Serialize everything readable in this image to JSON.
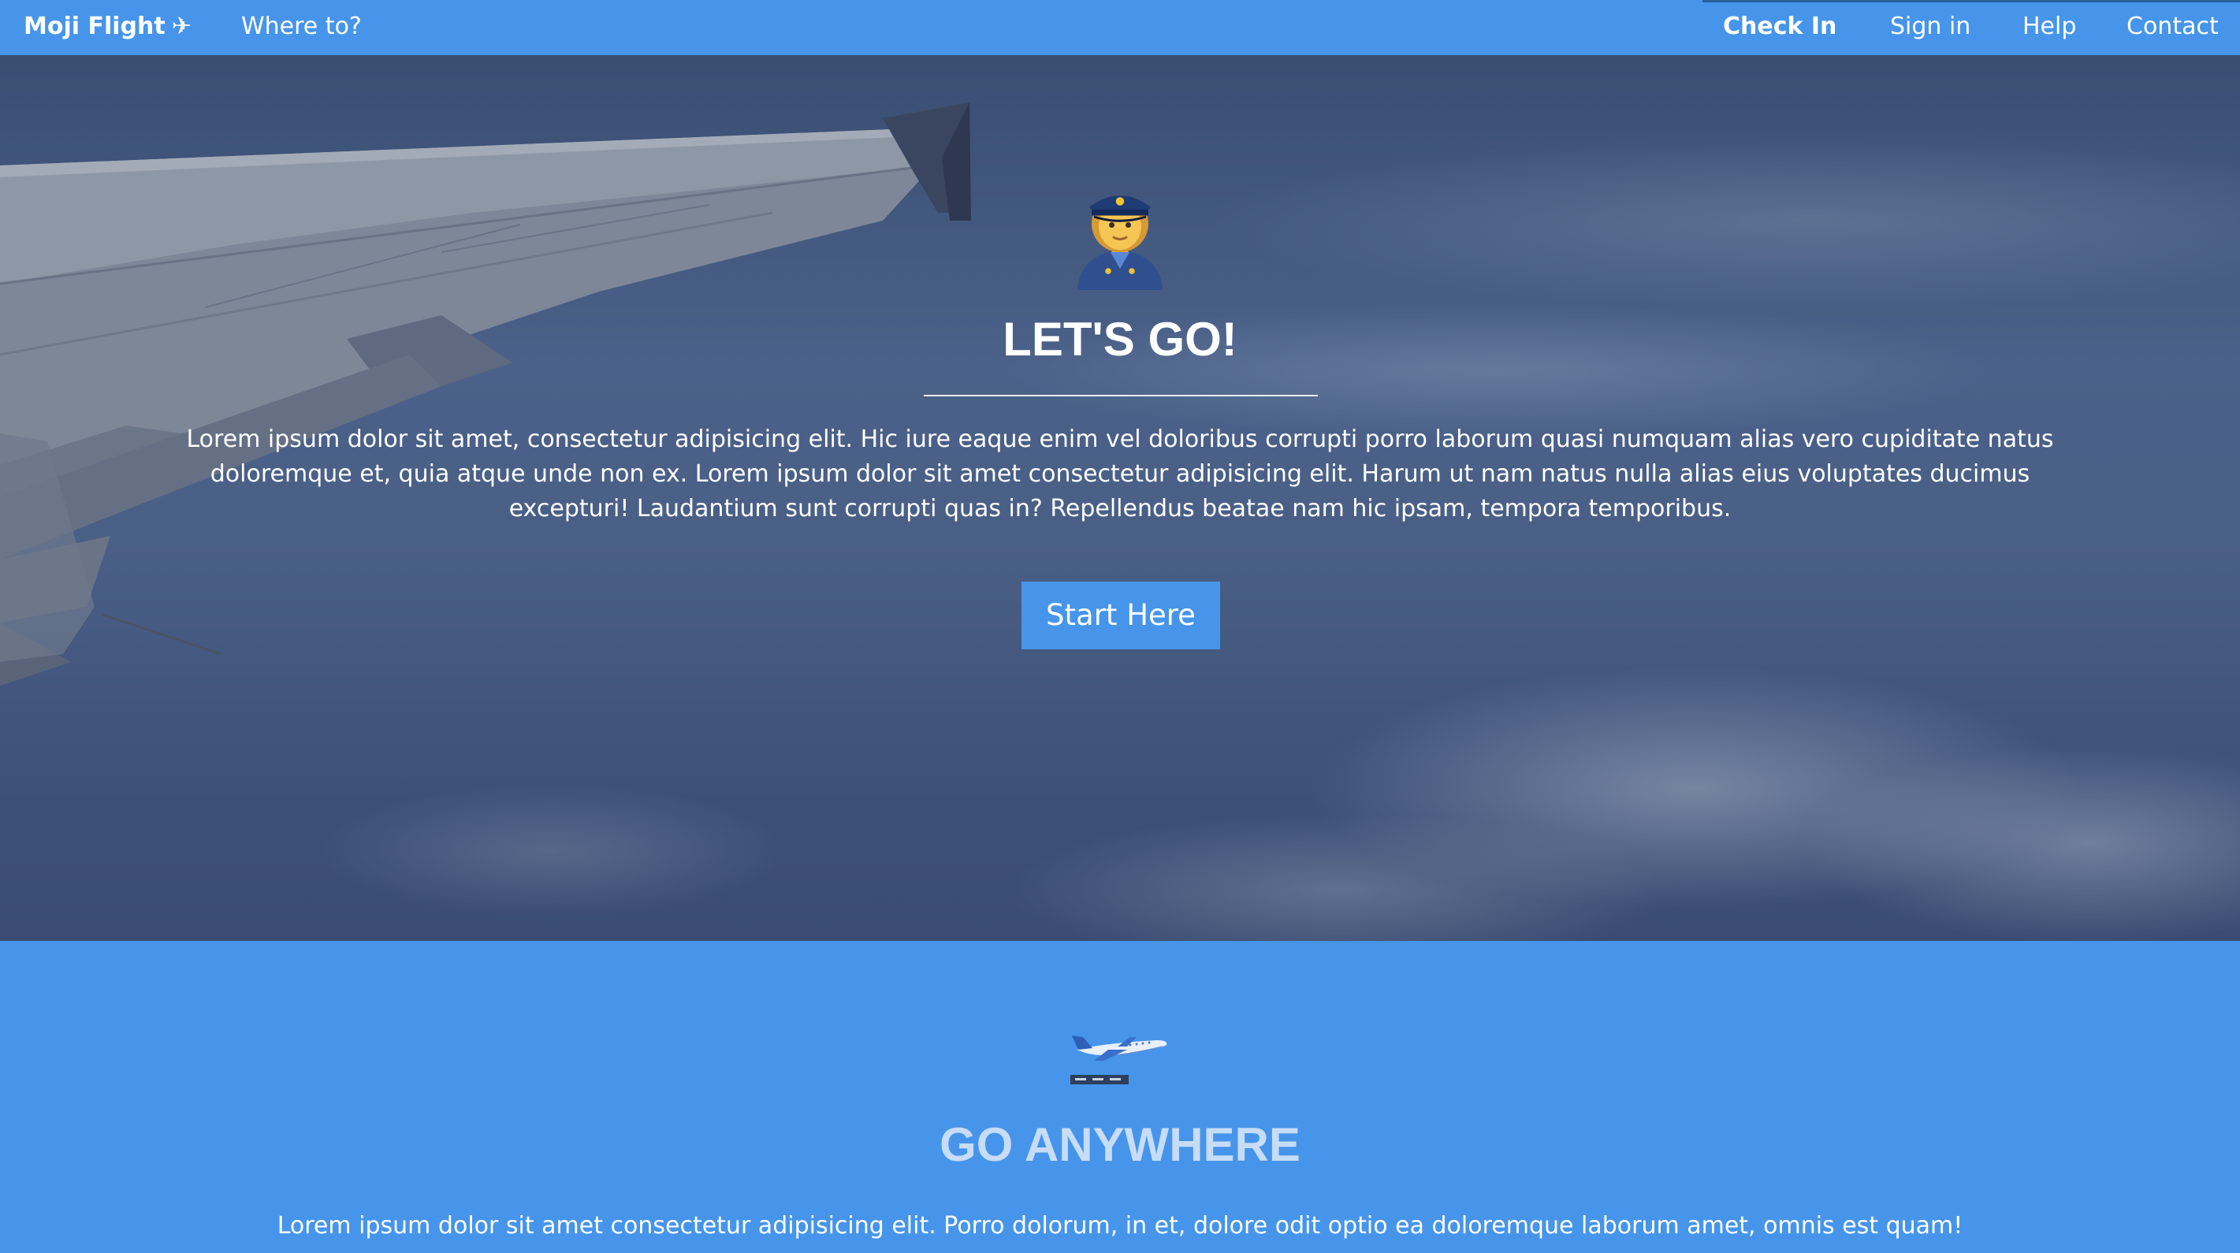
{
  "navbar": {
    "brand": "Moji Flight",
    "brand_icon": "✈",
    "links": {
      "where_to": "Where to?",
      "check_in": "Check In",
      "sign_in": "Sign in",
      "help": "Help",
      "contact": "Contact"
    },
    "background_color": "#4695eb"
  },
  "hero": {
    "icon": "police-officer-emoji",
    "title": "LET'S GO!",
    "body": "Lorem ipsum dolor sit amet, consectetur adipisicing elit. Hic iure eaque enim vel doloribus corrupti porro laborum quasi numquam alias vero cupiditate natus doloremque et, quia atque unde non ex. Lorem ipsum dolor sit amet consectetur adipisicing elit. Harum ut nam natus nulla alias eius voluptates ducimus excepturi! Laudantium sunt corrupti quas in? Repellendus beatae nam hic ipsam, tempora temporibus.",
    "button_label": "Start Here",
    "background_image": "airplane-wing-above-clouds-photo"
  },
  "section_go_anywhere": {
    "icon": "airplane-departure-emoji",
    "title": "GO ANYWHERE",
    "body": "Lorem ipsum dolor sit amet consectetur adipisicing elit. Porro dolorum, in et, dolore odit optio ea doloremque laborum amet, omnis est quam!",
    "background_color": "#4695eb"
  }
}
